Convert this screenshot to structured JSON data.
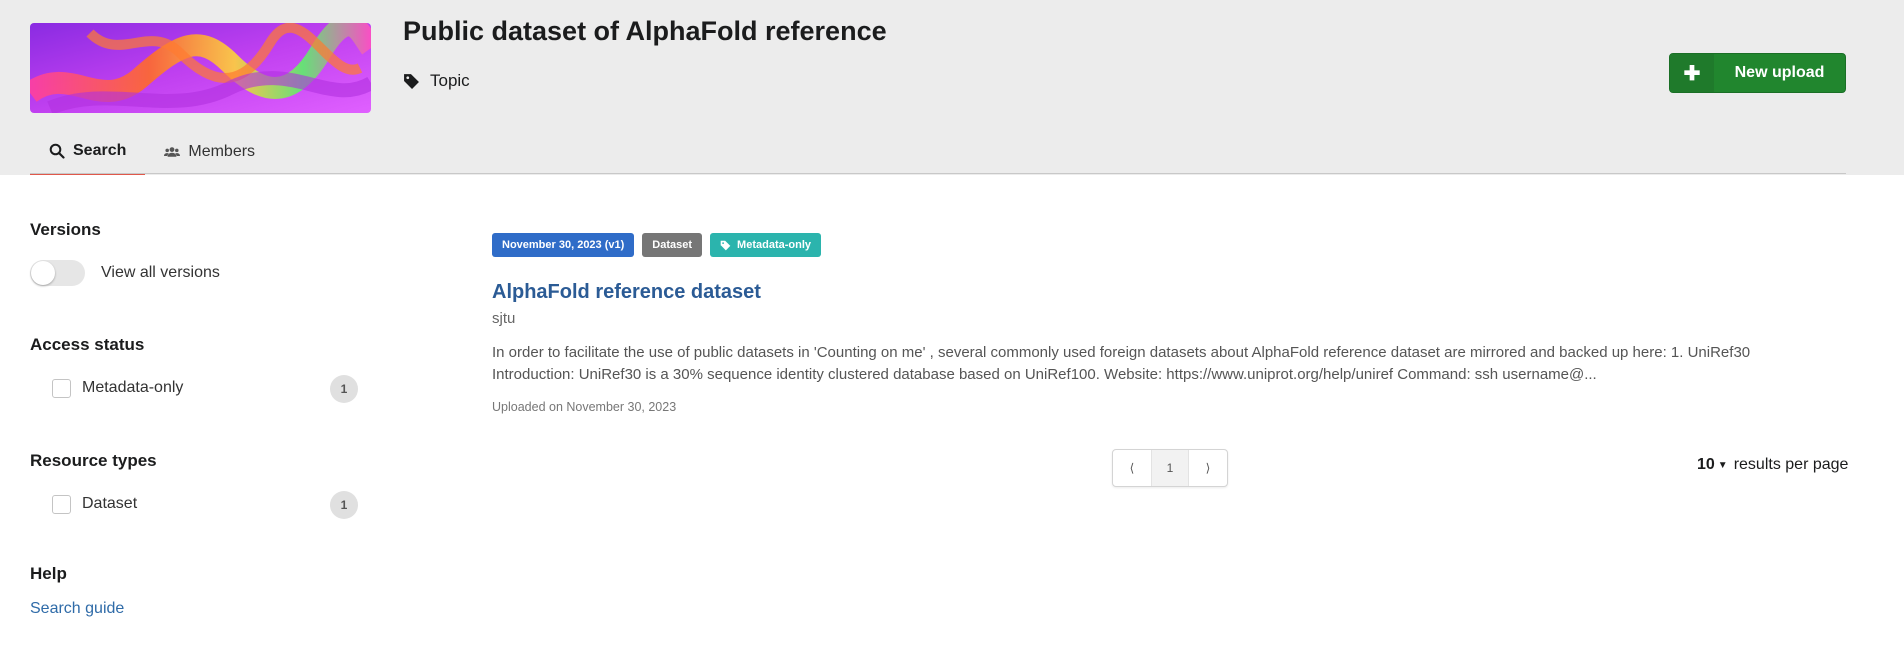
{
  "community": {
    "title": "Public dataset of AlphaFold reference",
    "type_label": "Topic",
    "new_upload_label": "New upload"
  },
  "tabs": [
    {
      "label": "Search",
      "icon": "search-icon",
      "active": true
    },
    {
      "label": "Members",
      "icon": "users-icon",
      "active": false
    }
  ],
  "sidebar": {
    "versions": {
      "title": "Versions",
      "toggle_label": "View all versions"
    },
    "access_status": {
      "title": "Access status",
      "items": [
        {
          "label": "Metadata-only",
          "count": "1"
        }
      ]
    },
    "resource_types": {
      "title": "Resource types",
      "items": [
        {
          "label": "Dataset",
          "count": "1"
        }
      ]
    },
    "help": {
      "title": "Help",
      "link_label": "Search guide"
    }
  },
  "results": [
    {
      "date_label": "November 30, 2023 (v1)",
      "type_label": "Dataset",
      "access_label": "Metadata-only",
      "title": "AlphaFold reference dataset",
      "creator": "sjtu",
      "description": "In order to facilitate the use of public datasets in 'Counting on me' , several commonly used foreign datasets about AlphaFold reference dataset are mirrored and backed up here: 1. UniRef30 Introduction: UniRef30 is a 30% sequence identity clustered database based on UniRef100. Website: https://www.uniprot.org/help/uniref Command: ssh username@...",
      "uploaded": "Uploaded on November 30, 2023"
    }
  ],
  "pagination": {
    "prev": "⟨",
    "current": "1",
    "next": "⟩"
  },
  "per_page": {
    "value": "10",
    "label": "results per page"
  },
  "colors": {
    "header_bg": "#ececec",
    "upload_green": "#21862e",
    "link_blue": "#2b5b95",
    "label_blue": "#2f6cc8",
    "label_grey": "#767676",
    "label_teal": "#2bb4ad",
    "tab_underline": "#e0574a"
  }
}
